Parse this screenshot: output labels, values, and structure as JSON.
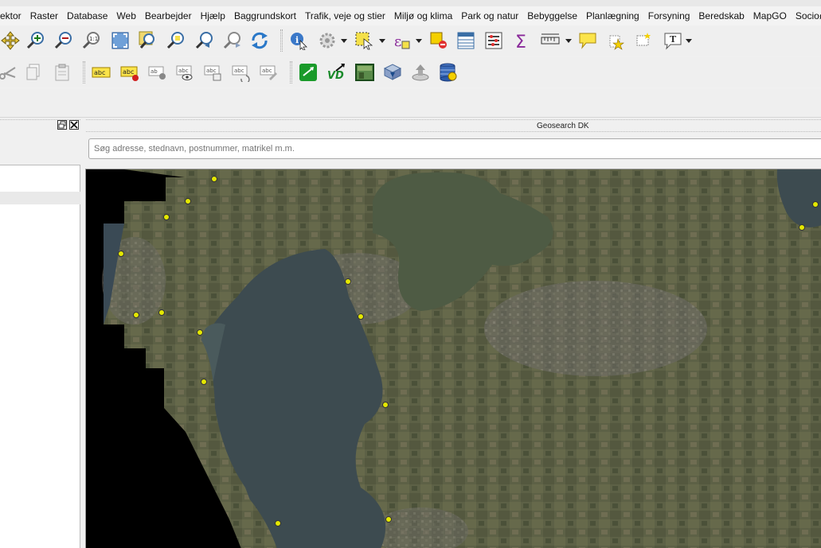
{
  "menu": [
    "ektor",
    "Raster",
    "Database",
    "Web",
    "Bearbejder",
    "Hjælp",
    "Baggrundskort",
    "Trafik, veje og stier",
    "Miljø og klima",
    "Park og natur",
    "Bebyggelse",
    "Planlægning",
    "Forsyning",
    "Beredskab",
    "MapGO",
    "Socioøkonomi"
  ],
  "geosearch": {
    "title": "Geosearch DK",
    "placeholder": "Søg adresse, stednavn, postnummer, matrikel m.m."
  },
  "colors": {
    "point_fill": "#e4e800",
    "water": "#3d4b50",
    "land": "#5b5f45",
    "lake": "#4e5b44"
  },
  "icons": {
    "toolbar1": [
      "pan-map-icon",
      "zoom-in-icon",
      "zoom-out-icon",
      "zoom-native-icon",
      "zoom-full-icon",
      "zoom-layer-icon",
      "zoom-selection-icon",
      "zoom-last-icon",
      "zoom-next-icon",
      "refresh-icon",
      "identify-icon",
      "action-icon",
      "select-feature-icon",
      "deselect-icon",
      "attribute-table-icon",
      "field-calculator-icon",
      "statistics-icon",
      "measure-icon",
      "map-tips-icon",
      "new-bookmark-icon",
      "show-bookmarks-icon",
      "text-annotation-icon"
    ],
    "toolbar2": [
      "cut-icon",
      "copy-icon",
      "paste-icon",
      "label-icon",
      "label-pin-icon",
      "label-show-icon",
      "label-hide-icon",
      "label-move-icon",
      "label-rotate-icon",
      "label-change-icon",
      "gps-icon",
      "vd-icon",
      "raster-icon",
      "download-icon",
      "upload-icon",
      "database-icon"
    ]
  }
}
